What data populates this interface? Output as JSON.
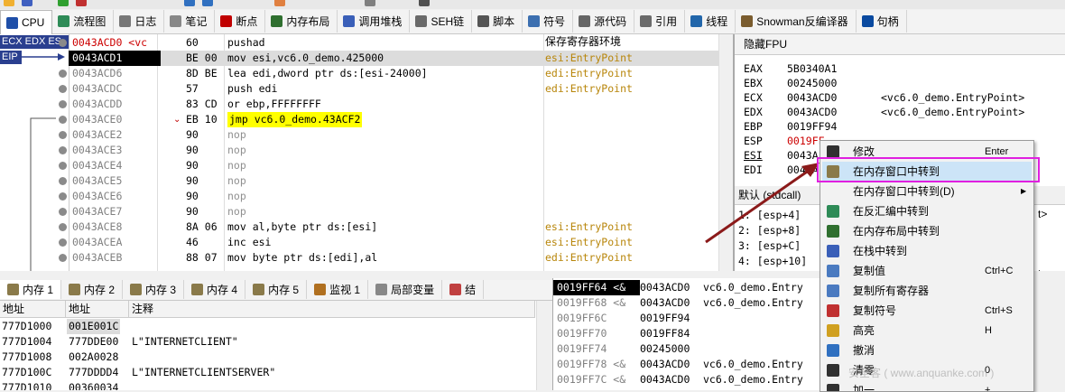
{
  "colors": {
    "accent_blue": "#2a3f8f",
    "selection_black": "#000000",
    "jump_yellow": "#ffff00",
    "comment_gold": "#b8860b",
    "menu_highlight": "#cce4f7",
    "highlight_box": "#e020e0",
    "arrow_red": "#8b1a1a"
  },
  "tabs": [
    {
      "label": "CPU",
      "icon": "cpu-icon"
    },
    {
      "label": "流程图",
      "icon": "flowchart-icon"
    },
    {
      "label": "日志",
      "icon": "log-icon"
    },
    {
      "label": "笔记",
      "icon": "notes-icon"
    },
    {
      "label": "断点",
      "icon": "breakpoint-icon"
    },
    {
      "label": "内存布局",
      "icon": "memory-map-icon"
    },
    {
      "label": "调用堆栈",
      "icon": "callstack-icon"
    },
    {
      "label": "SEH链",
      "icon": "seh-icon"
    },
    {
      "label": "脚本",
      "icon": "script-icon"
    },
    {
      "label": "符号",
      "icon": "symbol-icon"
    },
    {
      "label": "源代码",
      "icon": "source-icon"
    },
    {
      "label": "引用",
      "icon": "references-icon"
    },
    {
      "label": "线程",
      "icon": "threads-icon"
    },
    {
      "label": "Snowman反编译器",
      "icon": "snowman-icon"
    },
    {
      "label": "句柄",
      "icon": "handles-icon"
    }
  ],
  "cpu": {
    "reg_badges": [
      "ECX EDX ES",
      "EIP"
    ],
    "comment_header": "保存寄存器环境",
    "rows": [
      {
        "addr": "0043ACD0 <vc",
        "bytes": "60",
        "instr": "pushad",
        "comment": ""
      },
      {
        "addr": "0043ACD1",
        "bytes": "BE 00",
        "instr": "mov esi,vc6.0_demo.425000",
        "comment": "esi:EntryPoint"
      },
      {
        "addr": "0043ACD6",
        "bytes": "8D BE",
        "instr": "lea edi,dword ptr ds:[esi-24000]",
        "comment": "edi:EntryPoint"
      },
      {
        "addr": "0043ACDC",
        "bytes": "57",
        "instr": "push edi",
        "comment": "edi:EntryPoint"
      },
      {
        "addr": "0043ACDD",
        "bytes": "83 CD",
        "instr": "or ebp,FFFFFFFF",
        "comment": ""
      },
      {
        "addr": "0043ACE0",
        "bytes": "EB 10",
        "instr": "jmp vc6.0_demo.43ACF2",
        "comment": ""
      },
      {
        "addr": "0043ACE2",
        "bytes": "90",
        "instr": "nop",
        "comment": ""
      },
      {
        "addr": "0043ACE3",
        "bytes": "90",
        "instr": "nop",
        "comment": ""
      },
      {
        "addr": "0043ACE4",
        "bytes": "90",
        "instr": "nop",
        "comment": ""
      },
      {
        "addr": "0043ACE5",
        "bytes": "90",
        "instr": "nop",
        "comment": ""
      },
      {
        "addr": "0043ACE6",
        "bytes": "90",
        "instr": "nop",
        "comment": ""
      },
      {
        "addr": "0043ACE7",
        "bytes": "90",
        "instr": "nop",
        "comment": ""
      },
      {
        "addr": "0043ACE8",
        "bytes": "8A 06",
        "instr": "mov al,byte ptr ds:[esi]",
        "comment": "esi:EntryPoint"
      },
      {
        "addr": "0043ACEA",
        "bytes": "46",
        "instr": "inc esi",
        "comment": "esi:EntryPoint"
      },
      {
        "addr": "0043ACEB",
        "bytes": "88 07",
        "instr": "mov byte ptr ds:[edi],al",
        "comment": "edi:EntryPoint"
      }
    ]
  },
  "registers": {
    "title": "隐藏FPU",
    "rows": [
      {
        "name": "EAX",
        "value": "5B0340A1",
        "note": ""
      },
      {
        "name": "EBX",
        "value": "00245000",
        "note": ""
      },
      {
        "name": "ECX",
        "value": "0043ACD0",
        "note": "<vc6.0_demo.EntryPoint>"
      },
      {
        "name": "EDX",
        "value": "0043ACD0",
        "note": "<vc6.0_demo.EntryPoint>"
      },
      {
        "name": "EBP",
        "value": "0019FF94",
        "note": ""
      },
      {
        "name": "ESP",
        "value": "0019FF",
        "note": ""
      },
      {
        "name": "ESI",
        "value": "0043A",
        "note": ""
      },
      {
        "name": "EDI",
        "value": "0043A",
        "note": ""
      }
    ]
  },
  "args": {
    "title": "默认 (stdcall)",
    "rows": [
      "1: [esp+4]",
      "2: [esp+8]",
      "3: [esp+C]",
      "4: [esp+10]",
      "5: [esp+14]"
    ],
    "tail_top": "t>",
    "tail_bottom": "t>"
  },
  "lower_tabs": [
    {
      "label": "内存 1",
      "icon": "memory-icon"
    },
    {
      "label": "内存 2",
      "icon": "memory-icon"
    },
    {
      "label": "内存 3",
      "icon": "memory-icon"
    },
    {
      "label": "内存 4",
      "icon": "memory-icon"
    },
    {
      "label": "内存 5",
      "icon": "memory-icon"
    },
    {
      "label": "监视 1",
      "icon": "watch-icon"
    },
    {
      "label": "局部变量",
      "icon": "locals-icon"
    },
    {
      "label": "结",
      "icon": "struct-icon"
    }
  ],
  "dump": {
    "headers": [
      "地址",
      "地址",
      "注释"
    ],
    "rows": [
      {
        "addr": "777D1000",
        "val": "001E001C",
        "comment": ""
      },
      {
        "addr": "777D1004",
        "val": "777DDE00",
        "comment": "L\"INTERNETCLIENT\""
      },
      {
        "addr": "777D1008",
        "val": "002A0028",
        "comment": ""
      },
      {
        "addr": "777D100C",
        "val": "777DDDD4",
        "comment": "L\"INTERNETCLIENTSERVER\""
      },
      {
        "addr": "777D1010",
        "val": "00360034",
        "comment": ""
      }
    ]
  },
  "stack": {
    "rows": [
      {
        "addr": "0019FF64 <&",
        "val": "0043ACD0",
        "comment": "vc6.0_demo.Entry"
      },
      {
        "addr": "0019FF68 <&",
        "val": "0043ACD0",
        "comment": "vc6.0_demo.Entry"
      },
      {
        "addr": "0019FF6C",
        "val": "0019FF94",
        "comment": ""
      },
      {
        "addr": "0019FF70",
        "val": "0019FF84",
        "comment": ""
      },
      {
        "addr": "0019FF74",
        "val": "00245000",
        "comment": ""
      },
      {
        "addr": "0019FF78 <&",
        "val": "0043ACD0",
        "comment": "vc6.0_demo.Entry"
      },
      {
        "addr": "0019FF7C <&",
        "val": "0043ACD0",
        "comment": "vc6.0_demo.Entry"
      }
    ]
  },
  "menu": {
    "items": [
      {
        "label": "修改",
        "key": "Enter",
        "icon": "edit-icon"
      },
      {
        "label": "在内存窗口中转到",
        "key": "",
        "icon": "goto-dump-icon"
      },
      {
        "label": "在内存窗口中转到(D)",
        "key": "",
        "icon": "",
        "arrow": "▶"
      },
      {
        "label": "在反汇编中转到",
        "key": "",
        "icon": "goto-disasm-icon"
      },
      {
        "label": "在内存布局中转到",
        "key": "",
        "icon": "goto-memmap-icon"
      },
      {
        "label": "在栈中转到",
        "key": "",
        "icon": "goto-stack-icon"
      },
      {
        "label": "复制值",
        "key": "Ctrl+C",
        "icon": "copy-icon"
      },
      {
        "label": "复制所有寄存器",
        "key": "",
        "icon": "copy-all-icon"
      },
      {
        "label": "复制符号",
        "key": "Ctrl+S",
        "icon": "copy-symbol-icon"
      },
      {
        "label": "高亮",
        "key": "H",
        "icon": "highlight-icon"
      },
      {
        "label": "撤消",
        "key": "",
        "icon": "undo-icon"
      },
      {
        "label": "清零",
        "key": "0",
        "icon": "zero-icon"
      },
      {
        "label": "加一",
        "key": "+",
        "icon": "increment-icon"
      }
    ]
  },
  "watermark": "安全客 ( www.anquanke.com )"
}
